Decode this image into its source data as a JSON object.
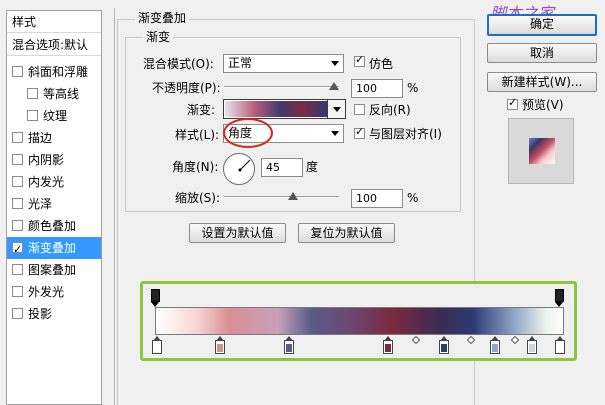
{
  "watermark": "脚本之家",
  "left_panel": {
    "header": "样式",
    "blend_options": "混合选项:默认",
    "items": [
      {
        "label": "斜面和浮雕",
        "checked": false
      },
      {
        "label": "等高线",
        "checked": false
      },
      {
        "label": "纹理",
        "checked": false
      },
      {
        "label": "描边",
        "checked": false
      },
      {
        "label": "内阴影",
        "checked": false
      },
      {
        "label": "内发光",
        "checked": false
      },
      {
        "label": "光泽",
        "checked": false
      },
      {
        "label": "颜色叠加",
        "checked": false
      },
      {
        "label": "渐变叠加",
        "checked": true
      },
      {
        "label": "图案叠加",
        "checked": false
      },
      {
        "label": "外发光",
        "checked": false
      },
      {
        "label": "投影",
        "checked": false
      }
    ]
  },
  "main": {
    "section_title": "渐变叠加",
    "group_title": "渐变",
    "blend_mode_label": "混合模式(O):",
    "blend_mode_value": "正常",
    "dither_label": "仿色",
    "dither_checked": true,
    "opacity_label": "不透明度(P):",
    "opacity_value": "100",
    "opacity_unit": "%",
    "opacity_level": 1.0,
    "gradient_label": "渐变:",
    "reverse_label": "反向(R)",
    "reverse_checked": false,
    "style_label": "样式(L):",
    "style_value": "角度",
    "align_label": "与图层对齐(I)",
    "align_checked": true,
    "angle_label": "角度(N):",
    "angle_value": "45",
    "angle_unit": "度",
    "scale_label": "缩放(S):",
    "scale_value": "100",
    "scale_unit": "%",
    "set_default_button": "设置为默认值",
    "reset_default_button": "复位为默认值"
  },
  "right": {
    "ok_button": "确定",
    "cancel_button": "取消",
    "new_style_button": "新建样式(W)...",
    "preview_label": "预览(V)",
    "preview_checked": true
  },
  "gradient_editor": {
    "color_stops": [
      "#ffffff",
      "#d98e93",
      "#5b5b8a",
      "#7b2a3d",
      "#2e3a73",
      "#8fa6c8",
      "#c9d6e0",
      "#ffffff"
    ]
  }
}
